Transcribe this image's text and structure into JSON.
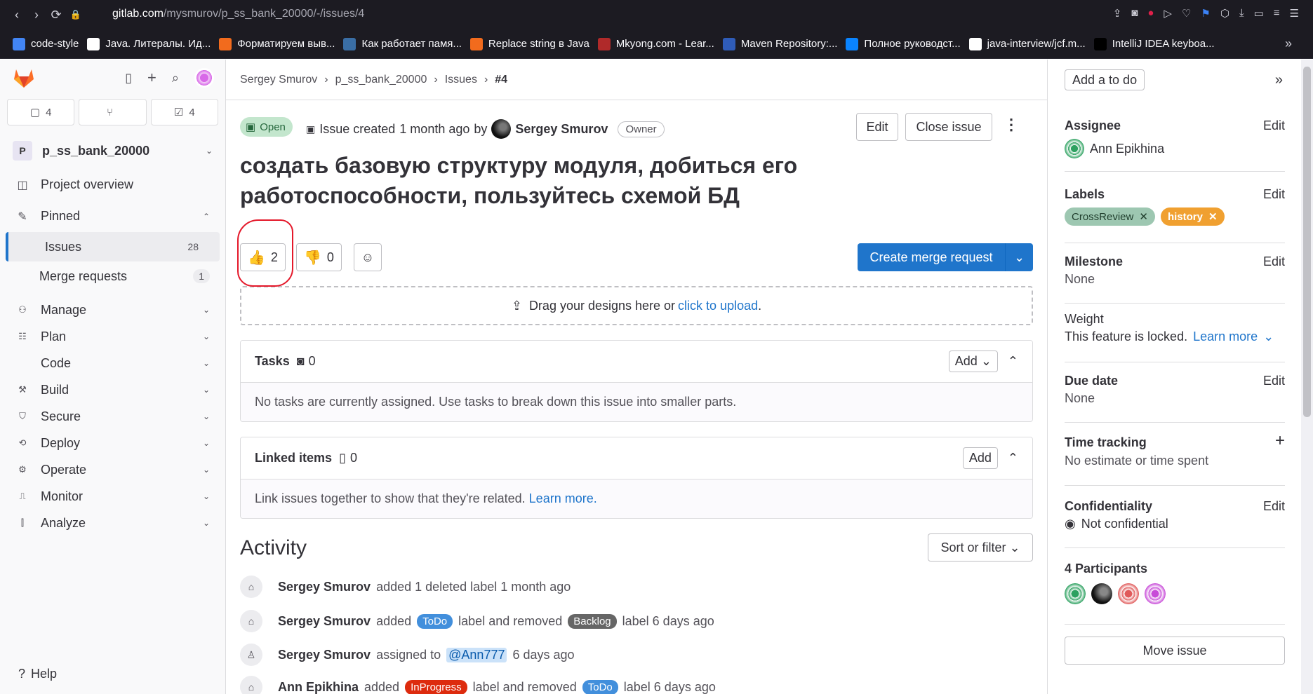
{
  "browser": {
    "url_host": "gitlab.com",
    "url_path": "/mysmurov/p_ss_bank_20000/-/issues/4",
    "bookmarks": [
      {
        "label": "code-style",
        "color": "#4285f4"
      },
      {
        "label": "Java. Литералы. Ид...",
        "color": "#ffffff"
      },
      {
        "label": "Форматируем выв...",
        "color": "#f26b1d"
      },
      {
        "label": "Как работает памя...",
        "color": "#3a6ea5"
      },
      {
        "label": "Replace string в Java",
        "color": "#f26b1d"
      },
      {
        "label": "Mkyong.com - Lear...",
        "color": "#b02a2a"
      },
      {
        "label": "Maven Repository:...",
        "color": "#2f5cb8"
      },
      {
        "label": "Полное руководст...",
        "color": "#0a84ff"
      },
      {
        "label": "java-interview/jcf.m...",
        "color": "#ffffff"
      },
      {
        "label": "IntelliJ IDEA keyboa...",
        "color": "#000000"
      }
    ]
  },
  "sidebar": {
    "counts": [
      {
        "icon": "issues-icon",
        "value": "4"
      },
      {
        "icon": "merge-request-icon",
        "value": ""
      },
      {
        "icon": "todo-icon",
        "value": "4"
      }
    ],
    "project_initial": "P",
    "project_name": "p_ss_bank_20000",
    "items": [
      {
        "label": "Project overview",
        "icon": "◉"
      },
      {
        "label": "Pinned",
        "icon": "📌"
      }
    ],
    "pinned": [
      {
        "label": "Issues",
        "count": "28"
      },
      {
        "label": "Merge requests",
        "count": "1"
      }
    ],
    "menu": [
      {
        "label": "Manage"
      },
      {
        "label": "Plan"
      },
      {
        "label": "Code"
      },
      {
        "label": "Build"
      },
      {
        "label": "Secure"
      },
      {
        "label": "Deploy"
      },
      {
        "label": "Operate"
      },
      {
        "label": "Monitor"
      },
      {
        "label": "Analyze"
      }
    ],
    "help": "Help"
  },
  "breadcrumb": [
    "Sergey Smurov",
    "p_ss_bank_20000",
    "Issues",
    "#4"
  ],
  "issue": {
    "status": "Open",
    "created_text": "Issue created",
    "created_when": "1 month ago",
    "by": "by",
    "author": "Sergey Smurov",
    "role": "Owner",
    "edit": "Edit",
    "close": "Close issue",
    "title": "создать базовую структуру модуля, добиться его работоспособности, пользуйтесь схемой БД",
    "thumbs_up": "2",
    "thumbs_down": "0",
    "create_mr": "Create merge request",
    "upload_text": "Drag your designs here or",
    "upload_link": "click to upload",
    "upload_end": "."
  },
  "tasks": {
    "title": "Tasks",
    "count": "0",
    "add": "Add",
    "empty": "No tasks are currently assigned. Use tasks to break down this issue into smaller parts."
  },
  "linked": {
    "title": "Linked items",
    "count": "0",
    "add": "Add",
    "empty": "Link issues together to show that they're related.",
    "learn": "Learn more."
  },
  "activity": {
    "title": "Activity",
    "sort": "Sort or filter",
    "items": [
      {
        "user": "Sergey Smurov",
        "t1": "added 1 deleted label 1 month ago"
      },
      {
        "user": "Sergey Smurov",
        "t1": "added",
        "chip1": "ToDo",
        "t2": "label and removed",
        "chip2": "Backlog",
        "t3": "label 6 days ago"
      },
      {
        "user": "Sergey Smurov",
        "t1": "assigned to",
        "mention": "@Ann777",
        "t2": "6 days ago"
      },
      {
        "user": "Ann Epikhina",
        "t1": "added",
        "chip1": "InProgress",
        "t2": "label and removed",
        "chip2": "ToDo",
        "t3": "label 6 days ago"
      }
    ]
  },
  "right": {
    "todo": "Add a to do",
    "assignee_title": "Assignee",
    "assignee_edit": "Edit",
    "assignee": "Ann Epikhina",
    "labels_title": "Labels",
    "labels_edit": "Edit",
    "label1": "CrossReview",
    "label2": "history",
    "milestone_title": "Milestone",
    "milestone_edit": "Edit",
    "milestone": "None",
    "weight_title": "Weight",
    "weight_text": "This feature is locked.",
    "weight_link": "Learn more",
    "due_title": "Due date",
    "due_edit": "Edit",
    "due": "None",
    "time_title": "Time tracking",
    "time": "No estimate or time spent",
    "conf_title": "Confidentiality",
    "conf_edit": "Edit",
    "conf": "Not confidential",
    "participants": "4 Participants",
    "move": "Move issue"
  },
  "colors": {
    "accent": "#1f75cb",
    "open_bg": "#c3e6cd",
    "label_crossreview": "#9dc7b1",
    "label_history": "#f0a030",
    "chip_todo": "#428fdc",
    "chip_backlog": "#666666",
    "chip_inprogress": "#dd2b0e"
  }
}
